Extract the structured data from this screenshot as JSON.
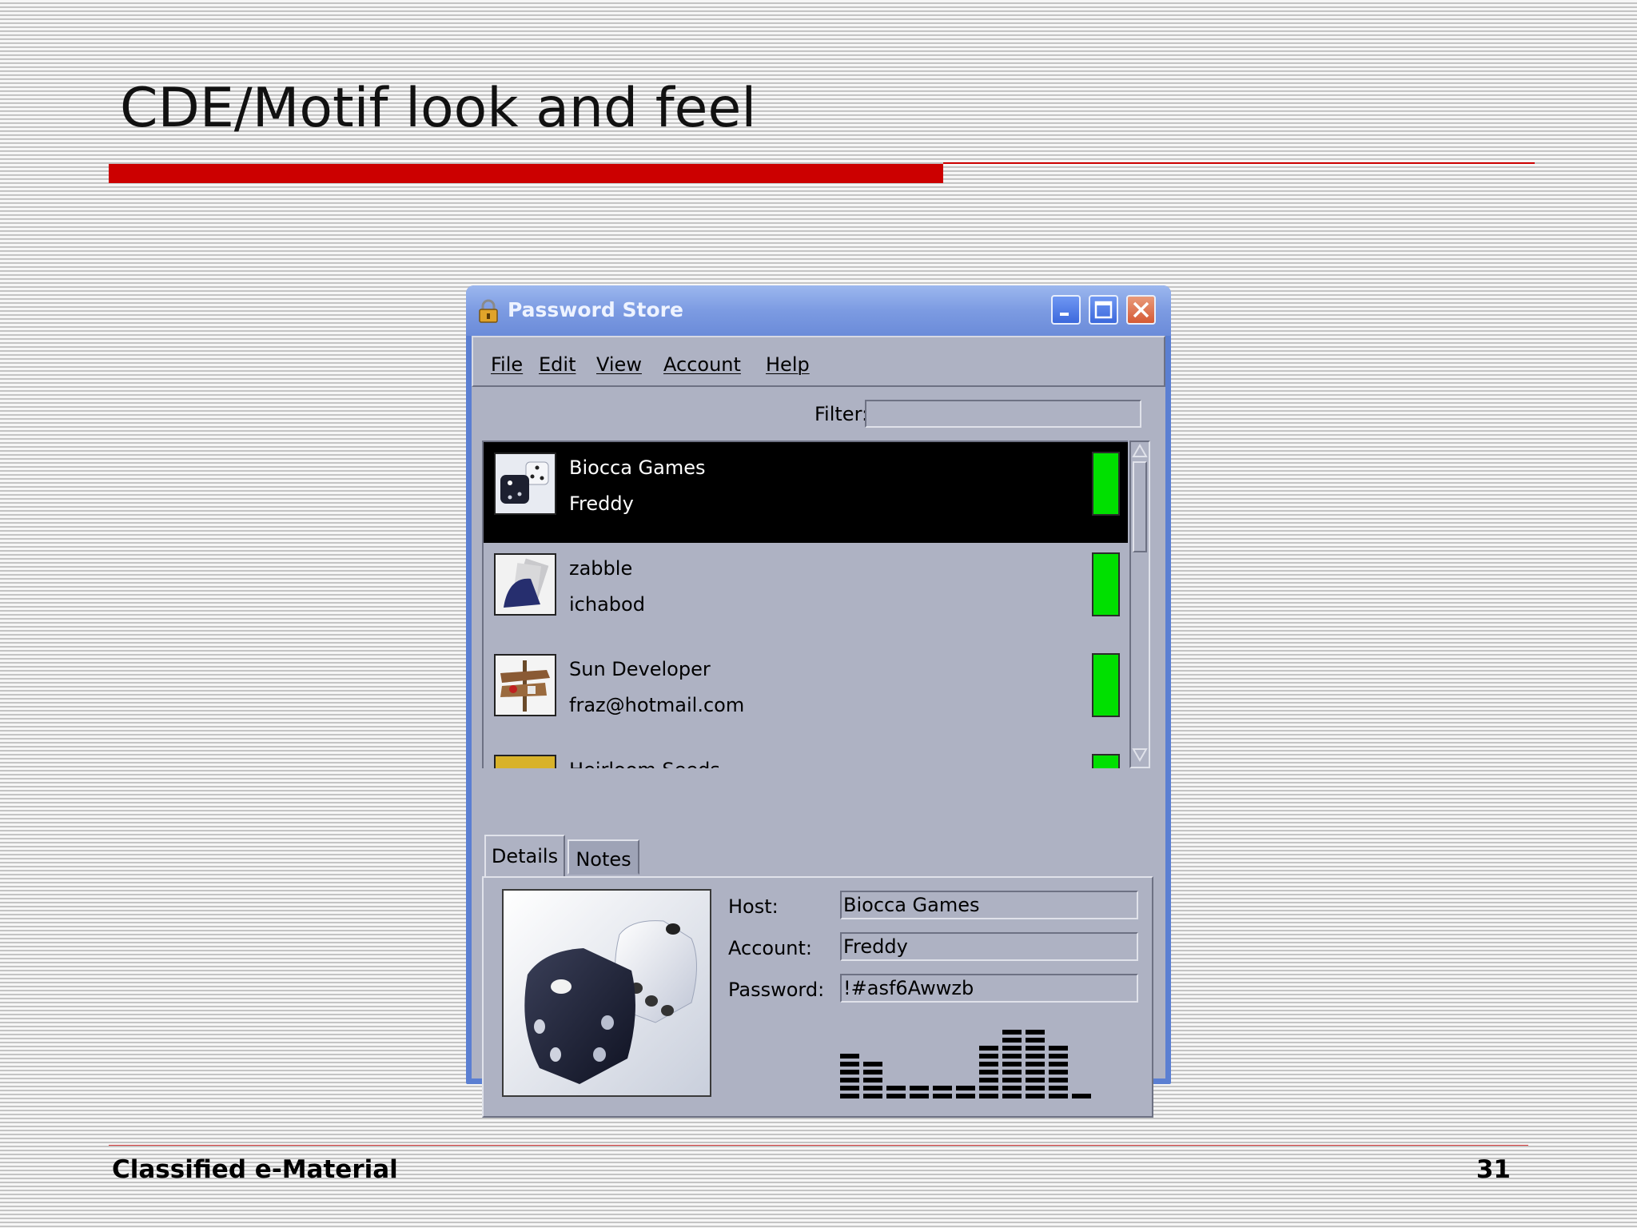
{
  "slide": {
    "title": "CDE/Motif look and feel",
    "footer": "Classified e-Material",
    "page_number": "31"
  },
  "window": {
    "title": "Password Store",
    "icon": "lock-icon",
    "controls": [
      "minimize-icon",
      "maximize-icon",
      "close-icon"
    ]
  },
  "menu": [
    "File",
    "Edit",
    "View",
    "Account",
    "Help"
  ],
  "filter": {
    "label": "Filter:",
    "value": ""
  },
  "accounts": [
    {
      "host": "Biocca Games",
      "user": "Freddy",
      "icon": "dice-icon",
      "selected": true,
      "strength_color": "#00e000"
    },
    {
      "host": "zabble",
      "user": "ichabod",
      "icon": "cards-icon",
      "selected": false,
      "strength_color": "#00e000"
    },
    {
      "host": "Sun Developer",
      "user": "fraz@hotmail.com",
      "icon": "signpost-icon",
      "selected": false,
      "strength_color": "#00e000"
    },
    {
      "host": "Heirloom Seeds",
      "user": "",
      "icon": "seeds-icon",
      "selected": false,
      "strength_color": "#00e000"
    }
  ],
  "tabs": [
    "Details",
    "Notes"
  ],
  "details": {
    "host_label": "Host:",
    "host_value": "Biocca Games",
    "account_label": "Account:",
    "account_value": "Freddy",
    "password_label": "Password:",
    "password_value": "!#asf6Awwzb"
  },
  "colors": {
    "strength": "#00e000",
    "accent": "#cc0000",
    "window_frame": "#5b7fd2"
  }
}
